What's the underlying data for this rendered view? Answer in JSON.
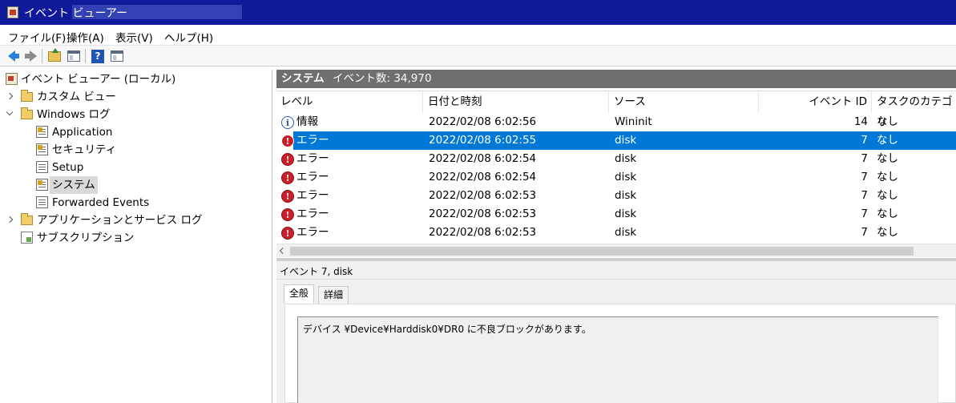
{
  "window": {
    "title": "イベント ビューアー"
  },
  "menu": [
    "ファイル(F)",
    "操作(A)",
    "表示(V)",
    "ヘルプ(H)"
  ],
  "tree": {
    "root": "イベント ビューアー (ローカル)",
    "custom_views": "カスタム ビュー",
    "windows_logs": "Windows ログ",
    "logs": [
      "Application",
      "セキュリティ",
      "Setup",
      "システム",
      "Forwarded Events"
    ],
    "apps_services": "アプリケーションとサービス ログ",
    "subscriptions": "サブスクリプション",
    "selected": "システム"
  },
  "panel": {
    "title": "システム",
    "event_count_label": "イベント数: 34,970"
  },
  "grid": {
    "columns": [
      "レベル",
      "日付と時刻",
      "ソース",
      "イベント ID",
      "タスクのカテゴリ"
    ],
    "rows": [
      {
        "level": "情報",
        "icon": "info-icon",
        "datetime": "2022/02/08 6:02:56",
        "source": "Wininit",
        "id": "14",
        "category": "なし"
      },
      {
        "level": "エラー",
        "icon": "error-icon",
        "datetime": "2022/02/08 6:02:55",
        "source": "disk",
        "id": "7",
        "category": "なし",
        "selected": true
      },
      {
        "level": "エラー",
        "icon": "error-icon",
        "datetime": "2022/02/08 6:02:54",
        "source": "disk",
        "id": "7",
        "category": "なし"
      },
      {
        "level": "エラー",
        "icon": "error-icon",
        "datetime": "2022/02/08 6:02:54",
        "source": "disk",
        "id": "7",
        "category": "なし"
      },
      {
        "level": "エラー",
        "icon": "error-icon",
        "datetime": "2022/02/08 6:02:53",
        "source": "disk",
        "id": "7",
        "category": "なし"
      },
      {
        "level": "エラー",
        "icon": "error-icon",
        "datetime": "2022/02/08 6:02:53",
        "source": "disk",
        "id": "7",
        "category": "なし"
      },
      {
        "level": "エラー",
        "icon": "error-icon",
        "datetime": "2022/02/08 6:02:53",
        "source": "disk",
        "id": "7",
        "category": "なし"
      }
    ]
  },
  "detail": {
    "title": "イベント 7, disk",
    "tabs": [
      "全般",
      "詳細"
    ],
    "active_tab": "全般",
    "message": "デバイス ¥Device¥Harddisk0¥DR0 に不良ブロックがあります。"
  },
  "colors": {
    "titlebar": "#0f1a9a",
    "selection": "#0078d7",
    "panel_header": "#6f6f6f",
    "error": "#c8202a"
  }
}
